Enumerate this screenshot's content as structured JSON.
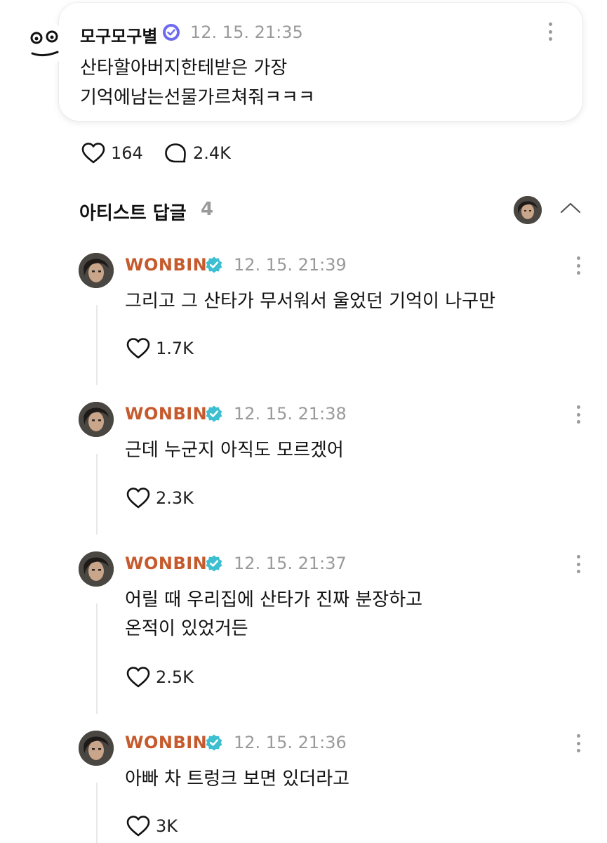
{
  "post": {
    "author": "모구모구별",
    "time": "12. 15. 21:35",
    "lines": [
      "산타할아버지한테받은 가장",
      "기억에남는선물가르쳐줘ㅋㅋㅋ"
    ],
    "likes": "164",
    "comments": "2.4K"
  },
  "section": {
    "title": "아티스트 답글",
    "count": "4"
  },
  "replies": [
    {
      "author": "WONBIN",
      "time": "12. 15. 21:39",
      "lines": [
        "그리고 그 산타가 무서워서 울었던 기억이 나구만"
      ],
      "likes": "1.7K"
    },
    {
      "author": "WONBIN",
      "time": "12. 15. 21:38",
      "lines": [
        "근데 누군지 아직도 모르겠어"
      ],
      "likes": "2.3K"
    },
    {
      "author": "WONBIN",
      "time": "12. 15. 21:37",
      "lines": [
        "어릴 때 우리집에 산타가 진짜 분장하고",
        "온적이 있었거든"
      ],
      "likes": "2.5K"
    },
    {
      "author": "WONBIN",
      "time": "12. 15. 21:36",
      "lines": [
        "아빠 차 트렁크 보면 있더라고"
      ],
      "likes": "3K"
    }
  ],
  "colors": {
    "artist_name": "#c65a2d",
    "verified": "#3cbfd0",
    "fan_badge": "#6e6af0",
    "muted": "#9a9a9a"
  }
}
